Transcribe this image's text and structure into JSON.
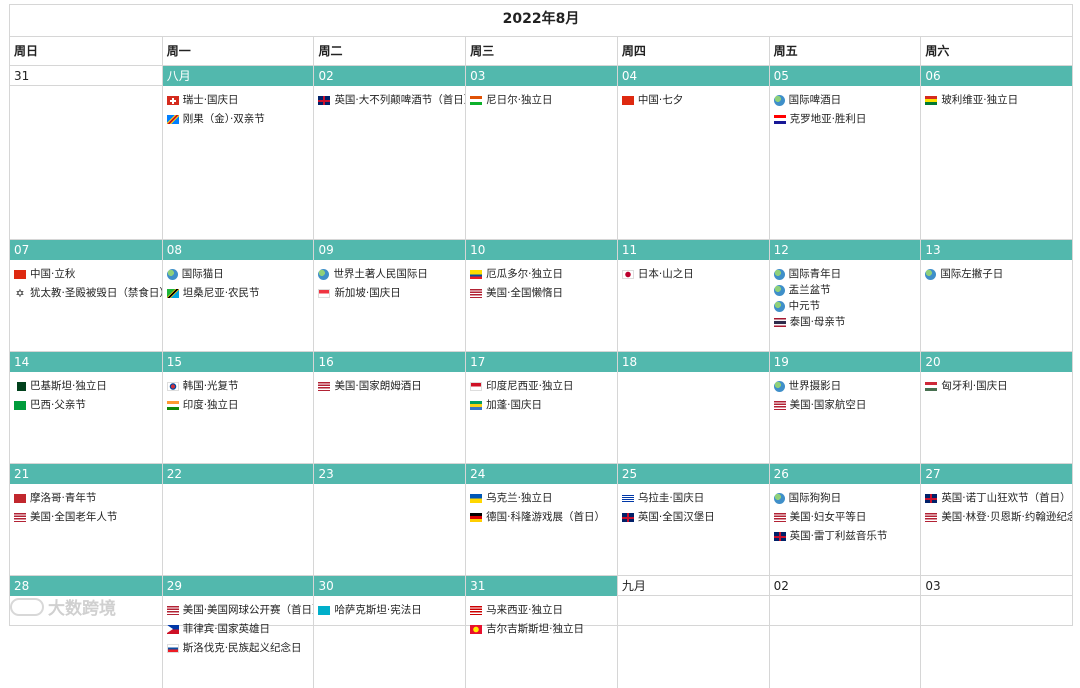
{
  "title": "2022年8月",
  "weekdays": [
    "周日",
    "周一",
    "周二",
    "周三",
    "周四",
    "周五",
    "周六"
  ],
  "weeks": [
    {
      "height": 174,
      "days": [
        {
          "label": "31",
          "current": false,
          "events": []
        },
        {
          "label": "八月",
          "current": true,
          "events": [
            {
              "icon": "switzerland-flag-icon",
              "flag": "ch",
              "text": "瑞士·国庆日"
            },
            {
              "icon": "congo-flag-icon",
              "flag": "cd",
              "text": "刚果（金）·双亲节"
            }
          ]
        },
        {
          "label": "02",
          "current": true,
          "events": [
            {
              "icon": "uk-flag-icon",
              "flag": "gb",
              "text": "英国·大不列颠啤酒节（首日）"
            }
          ]
        },
        {
          "label": "03",
          "current": true,
          "events": [
            {
              "icon": "niger-flag-icon",
              "flag": "ne",
              "text": "尼日尔·独立日"
            }
          ]
        },
        {
          "label": "04",
          "current": true,
          "events": [
            {
              "icon": "china-flag-icon",
              "flag": "cn",
              "text": "中国·七夕"
            }
          ]
        },
        {
          "label": "05",
          "current": true,
          "events": [
            {
              "icon": "globe-icon",
              "flag": "globe",
              "text": "国际啤酒日"
            },
            {
              "icon": "croatia-flag-icon",
              "flag": "hr",
              "text": "克罗地亚·胜利日"
            }
          ]
        },
        {
          "label": "06",
          "current": true,
          "events": [
            {
              "icon": "bolivia-flag-icon",
              "flag": "bo",
              "text": "玻利维亚·独立日"
            }
          ]
        }
      ]
    },
    {
      "height": 112,
      "days": [
        {
          "label": "07",
          "current": true,
          "events": [
            {
              "icon": "china-flag-icon",
              "flag": "cn",
              "text": "中国·立秋"
            },
            {
              "icon": "star-of-david-icon",
              "flag": "star",
              "text": "犹太教·圣殿被毁日（禁食日）"
            }
          ]
        },
        {
          "label": "08",
          "current": true,
          "events": [
            {
              "icon": "globe-icon",
              "flag": "globe",
              "text": "国际猫日"
            },
            {
              "icon": "tanzania-flag-icon",
              "flag": "tz",
              "text": "坦桑尼亚·农民节"
            }
          ]
        },
        {
          "label": "09",
          "current": true,
          "events": [
            {
              "icon": "globe-icon",
              "flag": "globe",
              "text": "世界土著人民国际日"
            },
            {
              "icon": "singapore-flag-icon",
              "flag": "sg",
              "text": "新加坡·国庆日"
            }
          ]
        },
        {
          "label": "10",
          "current": true,
          "events": [
            {
              "icon": "ecuador-flag-icon",
              "flag": "ec",
              "text": "厄瓜多尔·独立日"
            },
            {
              "icon": "usa-flag-icon",
              "flag": "us",
              "text": "美国·全国懒惰日"
            }
          ]
        },
        {
          "label": "11",
          "current": true,
          "events": [
            {
              "icon": "japan-flag-icon",
              "flag": "jp",
              "text": "日本·山之日"
            }
          ]
        },
        {
          "label": "12",
          "current": true,
          "compact": true,
          "events": [
            {
              "icon": "globe-icon",
              "flag": "globe",
              "text": "国际青年日"
            },
            {
              "icon": "globe-icon",
              "flag": "globe",
              "text": "盂兰盆节"
            },
            {
              "icon": "globe-icon",
              "flag": "globe",
              "text": "中元节"
            },
            {
              "icon": "thailand-flag-icon",
              "flag": "th",
              "text": "泰国·母亲节"
            }
          ]
        },
        {
          "label": "13",
          "current": true,
          "events": [
            {
              "icon": "globe-icon",
              "flag": "globe",
              "text": "国际左撇子日"
            }
          ]
        }
      ]
    },
    {
      "height": 112,
      "days": [
        {
          "label": "14",
          "current": true,
          "events": [
            {
              "icon": "pakistan-flag-icon",
              "flag": "pk",
              "text": "巴基斯坦·独立日"
            },
            {
              "icon": "brazil-flag-icon",
              "flag": "br",
              "text": "巴西·父亲节"
            }
          ]
        },
        {
          "label": "15",
          "current": true,
          "events": [
            {
              "icon": "south-korea-flag-icon",
              "flag": "kr",
              "text": "韩国·光复节"
            },
            {
              "icon": "india-flag-icon",
              "flag": "in",
              "text": "印度·独立日"
            }
          ]
        },
        {
          "label": "16",
          "current": true,
          "events": [
            {
              "icon": "usa-flag-icon",
              "flag": "us",
              "text": "美国·国家朗姆酒日"
            }
          ]
        },
        {
          "label": "17",
          "current": true,
          "events": [
            {
              "icon": "indonesia-flag-icon",
              "flag": "id",
              "text": "印度尼西亚·独立日"
            },
            {
              "icon": "gabon-flag-icon",
              "flag": "ga",
              "text": "加蓬·国庆日"
            }
          ]
        },
        {
          "label": "18",
          "current": true,
          "events": []
        },
        {
          "label": "19",
          "current": true,
          "events": [
            {
              "icon": "globe-icon",
              "flag": "globe",
              "text": "世界摄影日"
            },
            {
              "icon": "usa-flag-icon",
              "flag": "us",
              "text": "美国·国家航空日"
            }
          ]
        },
        {
          "label": "20",
          "current": true,
          "events": [
            {
              "icon": "hungary-flag-icon",
              "flag": "hu",
              "text": "匈牙利·国庆日"
            }
          ]
        }
      ]
    },
    {
      "height": 112,
      "days": [
        {
          "label": "21",
          "current": true,
          "events": [
            {
              "icon": "morocco-flag-icon",
              "flag": "ma",
              "text": "摩洛哥·青年节"
            },
            {
              "icon": "usa-flag-icon",
              "flag": "us",
              "text": "美国·全国老年人节"
            }
          ]
        },
        {
          "label": "22",
          "current": true,
          "events": []
        },
        {
          "label": "23",
          "current": true,
          "events": []
        },
        {
          "label": "24",
          "current": true,
          "events": [
            {
              "icon": "ukraine-flag-icon",
              "flag": "ua",
              "text": "乌克兰·独立日"
            },
            {
              "icon": "germany-flag-icon",
              "flag": "de",
              "text": "德国·科隆游戏展（首日）"
            }
          ]
        },
        {
          "label": "25",
          "current": true,
          "events": [
            {
              "icon": "uruguay-flag-icon",
              "flag": "uy",
              "text": "乌拉圭·国庆日"
            },
            {
              "icon": "uk-flag-icon",
              "flag": "gb",
              "text": "英国·全国汉堡日"
            }
          ]
        },
        {
          "label": "26",
          "current": true,
          "events": [
            {
              "icon": "globe-icon",
              "flag": "globe",
              "text": "国际狗狗日"
            },
            {
              "icon": "usa-flag-icon",
              "flag": "us",
              "text": "美国·妇女平等日"
            },
            {
              "icon": "uk-flag-icon",
              "flag": "gb",
              "text": "英国·雷丁利兹音乐节"
            }
          ]
        },
        {
          "label": "27",
          "current": true,
          "events": [
            {
              "icon": "uk-flag-icon",
              "flag": "gb",
              "text": "英国·诺丁山狂欢节（首日）"
            },
            {
              "icon": "usa-flag-icon",
              "flag": "us",
              "text": "美国·林登·贝恩斯·约翰逊纪念日"
            }
          ]
        }
      ]
    },
    {
      "height": 112,
      "days": [
        {
          "label": "28",
          "current": true,
          "events": []
        },
        {
          "label": "29",
          "current": true,
          "events": [
            {
              "icon": "usa-flag-icon",
              "flag": "us",
              "text": "美国·美国网球公开赛（首日）"
            },
            {
              "icon": "philippines-flag-icon",
              "flag": "ph",
              "text": "菲律宾·国家英雄日"
            },
            {
              "icon": "slovakia-flag-icon",
              "flag": "sk",
              "text": "斯洛伐克·民族起义纪念日"
            }
          ]
        },
        {
          "label": "30",
          "current": true,
          "events": [
            {
              "icon": "kazakhstan-flag-icon",
              "flag": "kz",
              "text": "哈萨克斯坦·宪法日"
            }
          ]
        },
        {
          "label": "31",
          "current": true,
          "events": [
            {
              "icon": "malaysia-flag-icon",
              "flag": "my",
              "text": "马来西亚·独立日"
            },
            {
              "icon": "kyrgyzstan-flag-icon",
              "flag": "kg",
              "text": "吉尔吉斯斯坦·独立日"
            }
          ]
        },
        {
          "label": "九月",
          "current": false,
          "events": []
        },
        {
          "label": "02",
          "current": false,
          "events": []
        },
        {
          "label": "03",
          "current": false,
          "events": []
        }
      ]
    }
  ],
  "watermark": "大数跨境",
  "colors": {
    "accent": "#52b8ad",
    "border": "#d6d6d6"
  }
}
